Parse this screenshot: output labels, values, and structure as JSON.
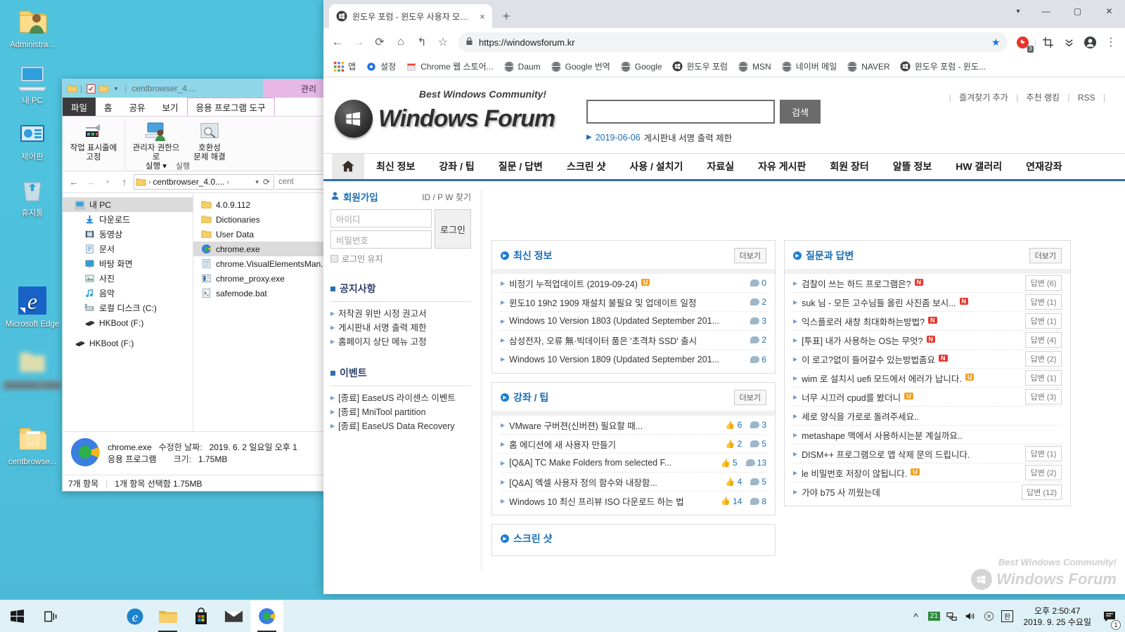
{
  "desktop": {
    "icons": [
      {
        "label": "Administra...",
        "icon": "user-folder-icon"
      },
      {
        "label": "내 PC",
        "icon": "this-pc-icon"
      },
      {
        "label": "제어판",
        "icon": "control-panel-icon"
      },
      {
        "label": "휴지통",
        "icon": "recycle-bin-icon"
      },
      {
        "label": "Microsoft Edge",
        "icon": "edge-icon"
      },
      {
        "label": "",
        "icon": "blurred-folder-icon"
      },
      {
        "label": "centbrowse...",
        "icon": "folder-icon"
      }
    ]
  },
  "taskbar": {
    "start": "start-icon",
    "taskview": "task-view-icon",
    "apps": [
      {
        "name": "edge",
        "icon": "edge-icon"
      },
      {
        "name": "file-explorer",
        "icon": "folder-icon"
      },
      {
        "name": "microsoft-store",
        "icon": "store-icon"
      },
      {
        "name": "mail",
        "icon": "mail-icon"
      },
      {
        "name": "centbrowser",
        "icon": "centbrowser-icon"
      }
    ],
    "tray": {
      "chevron": "^",
      "battery_badge": "21",
      "network": "network-icon",
      "volume": "volume-icon",
      "action": "x-icon",
      "ime": "한"
    },
    "clock": {
      "time": "오후 2:50:47",
      "date": "2019. 9. 25  수요일"
    },
    "notification_count": "1"
  },
  "explorer": {
    "title": "centbrowser_4....",
    "context_tab": "관리",
    "ribbon_tabs": [
      "파일",
      "홈",
      "공유",
      "보기",
      "응용 프로그램 도구"
    ],
    "ribbon": {
      "items": [
        {
          "label": "작업 표시줄에\n고정",
          "icon": "pin-icon"
        },
        {
          "label": "관리자 권한으로\n실행 ▾",
          "icon": "run-as-admin-icon"
        },
        {
          "label": "호환성\n문제 해결",
          "icon": "compatibility-icon"
        }
      ],
      "group_label": "실행"
    },
    "address": "centbrowser_4.0....",
    "search_placeholder": "cent",
    "tree": [
      {
        "label": "내 PC",
        "icon": "this-pc-icon",
        "level": 0,
        "selected": true
      },
      {
        "label": "다운로드",
        "icon": "downloads-icon",
        "level": 1,
        "selected": false
      },
      {
        "label": "동영상",
        "icon": "videos-icon",
        "level": 1,
        "selected": false
      },
      {
        "label": "문서",
        "icon": "documents-icon",
        "level": 1,
        "selected": false
      },
      {
        "label": "바탕 화면",
        "icon": "desktop-icon",
        "level": 1,
        "selected": false
      },
      {
        "label": "사진",
        "icon": "pictures-icon",
        "level": 1,
        "selected": false
      },
      {
        "label": "음악",
        "icon": "music-icon",
        "level": 1,
        "selected": false
      },
      {
        "label": "로컬 디스크 (C:)",
        "icon": "local-disk-icon",
        "level": 1,
        "selected": false
      },
      {
        "label": "HKBoot (F:)",
        "icon": "usb-drive-icon",
        "level": 1,
        "selected": false
      },
      {
        "label": "HKBoot (F:)",
        "icon": "usb-drive-icon",
        "level": 0,
        "selected": false
      }
    ],
    "files": [
      {
        "name": "4.0.9.112",
        "icon": "folder-icon",
        "selected": false
      },
      {
        "name": "Dictionaries",
        "icon": "folder-icon",
        "selected": false
      },
      {
        "name": "User Data",
        "icon": "folder-icon",
        "selected": false
      },
      {
        "name": "chrome.exe",
        "icon": "centbrowser-icon",
        "selected": true
      },
      {
        "name": "chrome.VisualElementsMan...",
        "icon": "xml-file-icon",
        "selected": false
      },
      {
        "name": "chrome_proxy.exe",
        "icon": "exe-file-icon",
        "selected": false
      },
      {
        "name": "safemode.bat",
        "icon": "bat-file-icon",
        "selected": false
      }
    ],
    "details": {
      "name": "chrome.exe",
      "date_label": "수정한 날짜:",
      "date_value": "2019. 6. 2  일요일 오후 1",
      "type": "응용 프로그램",
      "size_label": "크기:",
      "size_value": "1.75MB"
    },
    "status": {
      "count": "7개 항목",
      "selection": "1개 항목 선택함 1.75MB"
    }
  },
  "chrome": {
    "tab": {
      "title": "윈도우 포럼 - 윈도우 사용자 모…",
      "favicon": "windows-forum-favicon",
      "close": "×"
    },
    "newtab": "+",
    "window_controls": {
      "chevron": "▾",
      "minimize": "—",
      "maximize": "▢",
      "close": "✕"
    },
    "toolbar": {
      "back": "←",
      "forward": "→",
      "reload": "⟳",
      "home": "⌂",
      "undo": "↰",
      "bookmark_star": "☆",
      "url": "https://windowsforum.kr",
      "lock": "lock-icon",
      "star_filled": "★",
      "extension_badge": "3",
      "crop": "crop-icon",
      "chevrons": "chevrons-down-icon",
      "profile": "profile-icon",
      "menu": "⋮"
    },
    "bookmarks": [
      {
        "label": "앱",
        "icon": "apps-grid-icon"
      },
      {
        "label": "설정",
        "icon": "gear-icon"
      },
      {
        "label": "Chrome 웹 스토어...",
        "icon": "chrome-store-icon"
      },
      {
        "label": "Daum",
        "icon": "globe-icon"
      },
      {
        "label": "Google 번역",
        "icon": "globe-icon"
      },
      {
        "label": "Google",
        "icon": "globe-icon"
      },
      {
        "label": "윈도우 포럼",
        "icon": "windows-forum-favicon"
      },
      {
        "label": "MSN",
        "icon": "globe-icon"
      },
      {
        "label": "네이버 메일",
        "icon": "globe-icon"
      },
      {
        "label": "NAVER",
        "icon": "globe-icon"
      },
      {
        "label": "윈도우 포럼 - 윈도...",
        "icon": "windows-forum-favicon"
      }
    ]
  },
  "site": {
    "logo": {
      "tagline": "Best Windows Community!",
      "name": "Windows Forum"
    },
    "search": {
      "value": "",
      "button": "검색"
    },
    "notice": {
      "date": "2019-06-06",
      "text": "게시판내 서명 출력 제한"
    },
    "head_links": [
      "즐겨찾기 추가",
      "추천 랭킹",
      "RSS"
    ],
    "gnb": [
      "최신 정보",
      "강좌 / 팁",
      "질문 / 답변",
      "스크린 샷",
      "사용 / 설치기",
      "자료실",
      "자유 게시판",
      "회원 장터",
      "알뜰 정보",
      "HW 갤러리",
      "연재강좌"
    ],
    "sidebar": {
      "join": "회원가입",
      "idpw": "ID / P W 찾기",
      "id_placeholder": "아이디",
      "pw_placeholder": "비밀번호",
      "login_button": "로그인",
      "keep_login": "로그인 유지",
      "notice_title": "공지사항",
      "notices": [
        "저작권 위반 시정 권고서",
        "게시판내 서명 출력 제한",
        "홈페이지 상단 메뉴 고정"
      ],
      "event_title": "이벤트",
      "events": [
        "[종료] EaseUS 라이센스 이벤트",
        "[종료] MniTool partition",
        "[종료] EaseUS Data Recovery"
      ]
    },
    "more_label": "더보기",
    "panels": {
      "latest": {
        "title": "최신 정보",
        "rows": [
          {
            "title": "비정기 누적업데이트 (2019-09-24)",
            "badge": "U",
            "comments": "0"
          },
          {
            "title": "윈도10 19h2 1909 재설치 불필요 및 업데이트 일정",
            "badge": "",
            "comments": "2"
          },
          {
            "title": "Windows 10 Version 1803 (Updated September 201...",
            "badge": "",
            "comments": "3"
          },
          {
            "title": "삼성전자, 오류 無·빅데이터 품은 '초격차 SSD' 출시",
            "badge": "",
            "comments": "2"
          },
          {
            "title": "Windows 10 Version 1809 (Updated September 201...",
            "badge": "",
            "comments": "6"
          }
        ]
      },
      "tips": {
        "title": "강좌 / 팁",
        "rows": [
          {
            "title": "VMware 구버젼(신버젼) 필요할 때...",
            "likes": "6",
            "comments": "3"
          },
          {
            "title": "홈 에디션에 새 사용자 만들기",
            "likes": "2",
            "comments": "5"
          },
          {
            "title": "[Q&A] TC Make Folders from selected F...",
            "likes": "5",
            "comments": "13"
          },
          {
            "title": "[Q&A] 엑셀 사용자 정의 함수와 내장함...",
            "likes": "4",
            "comments": "5"
          },
          {
            "title": "Windows 10 최신 프리뷰 ISO 다운로드 하는 법",
            "likes": "14",
            "comments": "8"
          }
        ]
      },
      "screenshot": {
        "title": "스크린 샷"
      },
      "qna": {
        "title": "질문과 답변",
        "rows": [
          {
            "title": "검찰이 쓰는 하드 프로그램은?",
            "badge": "N",
            "answers": "답변 (6)"
          },
          {
            "title": "suk 님 - 모든 고수님들 올린 사진좀 보시...",
            "badge": "N",
            "answers": "답변 (1)"
          },
          {
            "title": "익스플로러 새창 최대화하는방법?",
            "badge": "N",
            "answers": "답변 (1)"
          },
          {
            "title": "[투표] 내가 사용하는 OS는 무엇?",
            "badge": "N",
            "answers": "답변 (4)"
          },
          {
            "title": "이 로고?없이 들어갈수 있는방법좀요",
            "badge": "N",
            "answers": "답변 (2)"
          },
          {
            "title": "wim 로 설치시 uefi 모드에서 에러가 납니다.",
            "badge": "U",
            "answers": "답변 (1)"
          },
          {
            "title": "너무 시끄러 cpud를 봤더니",
            "badge": "U",
            "answers": "답변 (3)"
          },
          {
            "title": "세로 양식을 가로로 돌려주세요..",
            "badge": "",
            "answers": ""
          },
          {
            "title": "metashape 맥에서 사용하시는분 계실까요..",
            "badge": "",
            "answers": ""
          },
          {
            "title": "DISM++ 프로그램으로 앱 삭제 문의 드립니다.",
            "badge": "",
            "answers": "답변 (1)"
          },
          {
            "title": "le 비밀번호 저장이 않됩니다.",
            "badge": "U",
            "answers": "답변 (2)"
          },
          {
            "title": "가야 b75 사 끼웠는데",
            "badge": "",
            "answers": "답변 (12)"
          }
        ]
      }
    },
    "watermark": {
      "tagline": "Best Windows Community!",
      "name": "Windows Forum"
    }
  }
}
